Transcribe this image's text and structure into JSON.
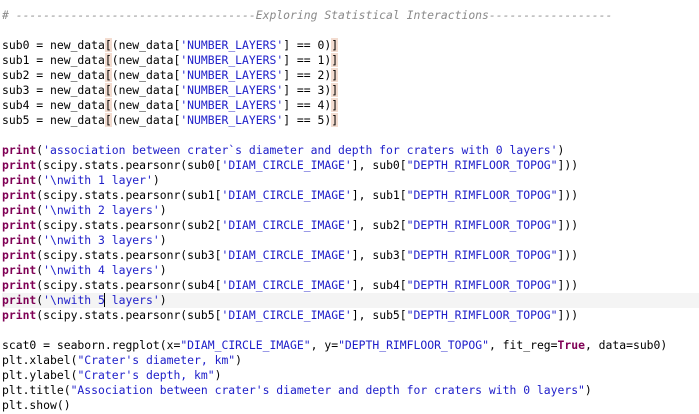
{
  "editor": {
    "lines": [
      {
        "parts": [
          {
            "t": "# -----------------------------------Exploring Statistical Interactions------------------",
            "c": "cmt"
          }
        ]
      },
      {
        "parts": []
      },
      {
        "parts": [
          {
            "t": "sub0 = new_data"
          },
          {
            "t": "[",
            "c": "br"
          },
          {
            "t": "(new_data["
          },
          {
            "t": "'NUMBER_LAYERS'",
            "c": "str"
          },
          {
            "t": "] == 0)"
          },
          {
            "t": "]",
            "c": "br"
          }
        ]
      },
      {
        "parts": [
          {
            "t": "sub1 = new_data"
          },
          {
            "t": "[",
            "c": "br"
          },
          {
            "t": "(new_data["
          },
          {
            "t": "'NUMBER_LAYERS'",
            "c": "str"
          },
          {
            "t": "] == 1)"
          },
          {
            "t": "]",
            "c": "br"
          }
        ]
      },
      {
        "parts": [
          {
            "t": "sub2 = new_data"
          },
          {
            "t": "[",
            "c": "br"
          },
          {
            "t": "(new_data["
          },
          {
            "t": "'NUMBER_LAYERS'",
            "c": "str"
          },
          {
            "t": "] == 2)"
          },
          {
            "t": "]",
            "c": "br"
          }
        ]
      },
      {
        "parts": [
          {
            "t": "sub3 = new_data"
          },
          {
            "t": "[",
            "c": "br"
          },
          {
            "t": "(new_data["
          },
          {
            "t": "'NUMBER_LAYERS'",
            "c": "str"
          },
          {
            "t": "] == 3)"
          },
          {
            "t": "]",
            "c": "br"
          }
        ]
      },
      {
        "parts": [
          {
            "t": "sub4 = new_data"
          },
          {
            "t": "[",
            "c": "br"
          },
          {
            "t": "(new_data["
          },
          {
            "t": "'NUMBER_LAYERS'",
            "c": "str"
          },
          {
            "t": "] == 4)"
          },
          {
            "t": "]",
            "c": "br"
          }
        ]
      },
      {
        "parts": [
          {
            "t": "sub5 = new_data"
          },
          {
            "t": "[",
            "c": "br"
          },
          {
            "t": "(new_data["
          },
          {
            "t": "'NUMBER_LAYERS'",
            "c": "str"
          },
          {
            "t": "] == 5)"
          },
          {
            "t": "]",
            "c": "br"
          }
        ]
      },
      {
        "parts": []
      },
      {
        "parts": [
          {
            "t": "print",
            "c": "kw"
          },
          {
            "t": "("
          },
          {
            "t": "'association between crater`s diameter and depth for craters with 0 layers'",
            "c": "str"
          },
          {
            "t": ")"
          }
        ]
      },
      {
        "parts": [
          {
            "t": "print",
            "c": "kw"
          },
          {
            "t": "(scipy.stats.pearsonr(sub0["
          },
          {
            "t": "'DIAM_CIRCLE_IMAGE'",
            "c": "str"
          },
          {
            "t": "], sub0["
          },
          {
            "t": "\"DEPTH_RIMFLOOR_TOPOG\"",
            "c": "str"
          },
          {
            "t": "]))"
          }
        ]
      },
      {
        "parts": [
          {
            "t": "print",
            "c": "kw"
          },
          {
            "t": "("
          },
          {
            "t": "'\\nwith 1 layer'",
            "c": "str"
          },
          {
            "t": ")"
          }
        ]
      },
      {
        "parts": [
          {
            "t": "print",
            "c": "kw"
          },
          {
            "t": "(scipy.stats.pearsonr(sub1["
          },
          {
            "t": "'DIAM_CIRCLE_IMAGE'",
            "c": "str"
          },
          {
            "t": "], sub1["
          },
          {
            "t": "\"DEPTH_RIMFLOOR_TOPOG\"",
            "c": "str"
          },
          {
            "t": "]))"
          }
        ]
      },
      {
        "parts": [
          {
            "t": "print",
            "c": "kw"
          },
          {
            "t": "("
          },
          {
            "t": "'\\nwith 2 layers'",
            "c": "str"
          },
          {
            "t": ")"
          }
        ]
      },
      {
        "parts": [
          {
            "t": "print",
            "c": "kw"
          },
          {
            "t": "(scipy.stats.pearsonr(sub2["
          },
          {
            "t": "'DIAM_CIRCLE_IMAGE'",
            "c": "str"
          },
          {
            "t": "], sub2["
          },
          {
            "t": "\"DEPTH_RIMFLOOR_TOPOG\"",
            "c": "str"
          },
          {
            "t": "]))"
          }
        ]
      },
      {
        "parts": [
          {
            "t": "print",
            "c": "kw"
          },
          {
            "t": "("
          },
          {
            "t": "'\\nwith 3 layers'",
            "c": "str"
          },
          {
            "t": ")"
          }
        ]
      },
      {
        "parts": [
          {
            "t": "print",
            "c": "kw"
          },
          {
            "t": "(scipy.stats.pearsonr(sub3["
          },
          {
            "t": "'DIAM_CIRCLE_IMAGE'",
            "c": "str"
          },
          {
            "t": "], sub3["
          },
          {
            "t": "\"DEPTH_RIMFLOOR_TOPOG\"",
            "c": "str"
          },
          {
            "t": "]))"
          }
        ]
      },
      {
        "parts": [
          {
            "t": "print",
            "c": "kw"
          },
          {
            "t": "("
          },
          {
            "t": "'\\nwith 4 layers'",
            "c": "str"
          },
          {
            "t": ")"
          }
        ]
      },
      {
        "parts": [
          {
            "t": "print",
            "c": "kw"
          },
          {
            "t": "(scipy.stats.pearsonr(sub4["
          },
          {
            "t": "'DIAM_CIRCLE_IMAGE'",
            "c": "str"
          },
          {
            "t": "], sub4["
          },
          {
            "t": "\"DEPTH_RIMFLOOR_TOPOG\"",
            "c": "str"
          },
          {
            "t": "]))"
          }
        ]
      },
      {
        "current": true,
        "parts": [
          {
            "t": "print",
            "c": "kw"
          },
          {
            "t": "("
          },
          {
            "t": "'\\nwith 5",
            "c": "str"
          },
          {
            "t": " layers'",
            "c": "str caret"
          },
          {
            "t": ")"
          }
        ]
      },
      {
        "parts": [
          {
            "t": "print",
            "c": "kw"
          },
          {
            "t": "(scipy.stats.pearsonr(sub5["
          },
          {
            "t": "'DIAM_CIRCLE_IMAGE'",
            "c": "str"
          },
          {
            "t": "], sub5["
          },
          {
            "t": "\"DEPTH_RIMFLOOR_TOPOG\"",
            "c": "str"
          },
          {
            "t": "]))"
          }
        ]
      },
      {
        "parts": []
      },
      {
        "parts": [
          {
            "t": "scat0 = seaborn.regplot(x="
          },
          {
            "t": "\"DIAM_CIRCLE_IMAGE\"",
            "c": "str"
          },
          {
            "t": ", y="
          },
          {
            "t": "\"DEPTH_RIMFLOOR_TOPOG\"",
            "c": "str"
          },
          {
            "t": ", fit_reg="
          },
          {
            "t": "True",
            "c": "kw"
          },
          {
            "t": ", data=sub0)"
          }
        ]
      },
      {
        "parts": [
          {
            "t": "plt.xlabel("
          },
          {
            "t": "\"Crater's diameter, km\"",
            "c": "str"
          },
          {
            "t": ")"
          }
        ]
      },
      {
        "parts": [
          {
            "t": "plt.ylabel("
          },
          {
            "t": "\"Crater's depth, km\"",
            "c": "str"
          },
          {
            "t": ")"
          }
        ]
      },
      {
        "parts": [
          {
            "t": "plt.title("
          },
          {
            "t": "\"Association between crater's diameter and depth for craters with 0 layers\"",
            "c": "str"
          },
          {
            "t": ")"
          }
        ]
      },
      {
        "parts": [
          {
            "t": "plt.show()"
          }
        ]
      }
    ]
  }
}
